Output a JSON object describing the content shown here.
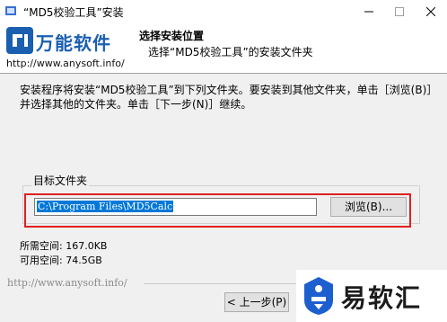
{
  "window": {
    "title": "“MD5校验工具”安装",
    "icons": {
      "app": "installer-icon",
      "minimize": "minimize-icon",
      "maximize": "maximize-icon",
      "close": "close-icon"
    }
  },
  "header": {
    "logo_name": "万能软件",
    "logo_url": "http://www.anysoft.info/",
    "title": "选择安装位置",
    "subtitle": "选择“MD5校验工具”的安装文件夹"
  },
  "content": {
    "description": "安装程序将安装“MD5校验工具”到下列文件夹。要安装到其他文件夹，单击［浏览(B)］并选择其他的文件夹。单击［下一步(N)］继续。",
    "group_label": "目标文件夹",
    "install_path": "C:\\Program Files\\MD5Calc",
    "browse_label": "浏览(B)...",
    "space_required": "所需空间: 167.0KB",
    "space_available": "可用空间: 74.5GB"
  },
  "footer": {
    "brand": "http://www.anysoft.info/",
    "back_label": "< 上一步(P)"
  },
  "watermark": {
    "text": "易软汇",
    "icon": "yiruanhui-logo-icon"
  },
  "colors": {
    "accent": "#1a5fb0",
    "highlight_border": "#e02020",
    "selection": "#0078d7"
  }
}
